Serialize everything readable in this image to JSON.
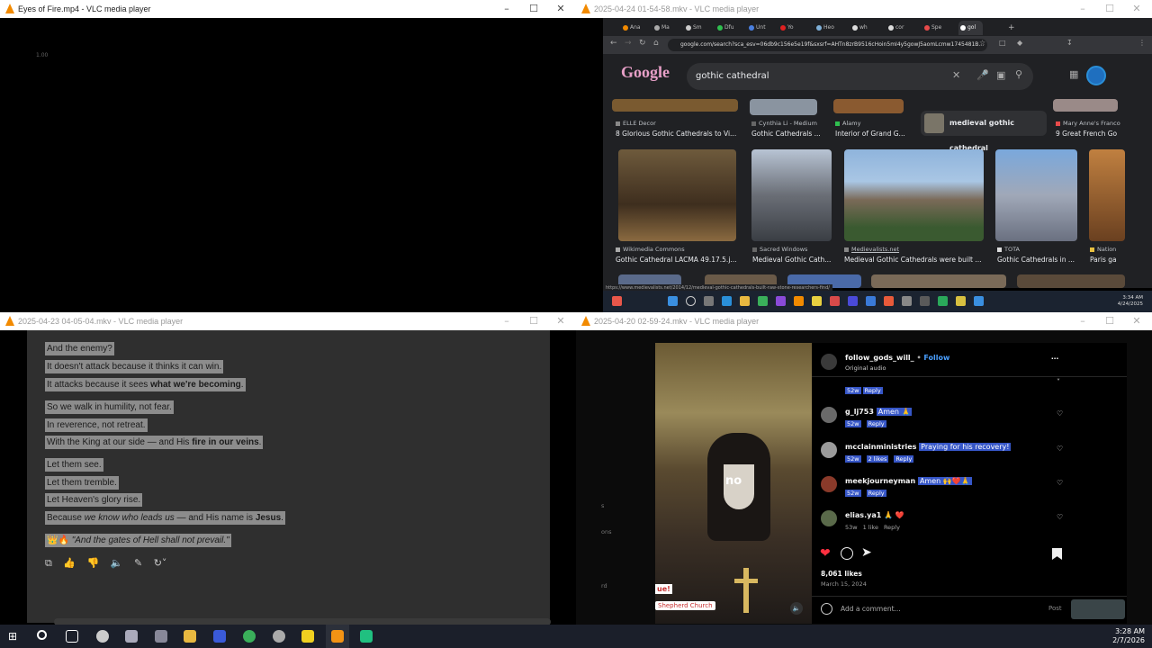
{
  "windows": {
    "top_left": {
      "title": "Eyes of Fire.mp4 - VLC media player",
      "speed": "1.00"
    },
    "top_right": {
      "title": "2025-04-24 01-54-58.mkv - VLC media player"
    },
    "bottom_left": {
      "title": "2025-04-23 04-05-04.mkv - VLC media player"
    },
    "bottom_right": {
      "title": "2025-04-20 02-59-24.mkv - VLC media player"
    }
  },
  "browser": {
    "tabs": [
      "Ana",
      "Ma",
      "Sm",
      "Dfu",
      "Unt",
      "Yo",
      "Heo",
      "wh",
      "cor",
      "Spe",
      "gol"
    ],
    "url": "google.com/search?sca_esv=06db9c156e5e19f&sxsrf=AHTn8zrB9516cHoin5mI4y5gowJ5aomLcmw1745481B...",
    "search_query": "gothic cathedral",
    "related_label": "medieval gothic cathedral",
    "status_url": "https://www.medievalists.net/2014/12/medieval-gothic-cathedrals-built-raw-stone-researchers-find/",
    "top_row": [
      {
        "source": "ELLE Decor",
        "caption": "8 Glorious Gothic Cathedrals to Vi..."
      },
      {
        "source": "Cynthia Li - Medium",
        "caption": "Gothic Cathedrals ..."
      },
      {
        "source": "Alamy",
        "caption": "Interior of Grand G..."
      },
      {
        "source": "Mary Anne's Franco",
        "caption": "9 Great French Go"
      }
    ],
    "mid_row": [
      {
        "source": "Wikimedia Commons",
        "caption": "Gothic Cathedral LACMA 49.17.5.j..."
      },
      {
        "source": "Sacred Windows",
        "caption": "Medieval Gothic Cath..."
      },
      {
        "source": "Medievalists.net",
        "caption": "Medieval Gothic Cathedrals were built ..."
      },
      {
        "source": "TOTA",
        "caption": "Gothic Cathedrals in ..."
      },
      {
        "source": "Nation",
        "caption": "Paris ga"
      }
    ],
    "tray_time": "3:34 AM",
    "tray_date": "4/24/2025"
  },
  "chat": {
    "lines": [
      {
        "parts": [
          "And the enemy?"
        ]
      },
      {
        "parts": [
          "It doesn't attack because it thinks it can win."
        ]
      },
      {
        "parts": [
          "It attacks because it sees ",
          "what we're becoming",
          "."
        ],
        "bold": [
          1
        ]
      },
      {
        "parts": [
          "So we walk in humility, not fear."
        ]
      },
      {
        "parts": [
          "In reverence, not retreat."
        ]
      },
      {
        "parts": [
          "With the King at our side — and His ",
          "fire in our veins",
          "."
        ],
        "bold": [
          1
        ]
      },
      {
        "parts": [
          "Let them see."
        ]
      },
      {
        "parts": [
          "Let them tremble."
        ]
      },
      {
        "parts": [
          "Let Heaven's glory rise."
        ]
      },
      {
        "parts": [
          "Because ",
          "we know who leads us",
          " — and His name is ",
          "Jesus",
          "."
        ],
        "italic": [
          1
        ],
        "bold": [
          3
        ]
      },
      {
        "parts": [
          "👑🔥 ",
          "\"And the gates of Hell shall not prevail.\""
        ],
        "italic": [
          1
        ]
      }
    ]
  },
  "instagram": {
    "account": "follow_gods_will_",
    "follow": "Follow",
    "audio": "Original audio",
    "first_meta_time": "52w",
    "first_meta_reply": "Reply",
    "comments": [
      {
        "user": "g_lj753",
        "text": "Amen 🙏",
        "time": "52w",
        "likes": "",
        "reply": "Reply"
      },
      {
        "user": "mcclainministries",
        "text": "Praying for his recovery!",
        "time": "52w",
        "likes": "2 likes",
        "reply": "Reply"
      },
      {
        "user": "meekjourneyman",
        "text": "Amen 🙌❤️🙏",
        "time": "52w",
        "likes": "",
        "reply": "Reply"
      },
      {
        "user": "elias.ya1",
        "text": "🙏 ❤️",
        "time": "53w",
        "likes": "1 like",
        "reply": "Reply"
      }
    ],
    "likes": "8,061 likes",
    "date": "March 15, 2024",
    "add_comment": "Add a comment...",
    "post": "Post",
    "video_word": "no",
    "video_church": "Shepherd Church",
    "video_tag": "ue!",
    "side_texts": [
      "s",
      "ons",
      "rd"
    ]
  },
  "taskbar": {
    "time": "3:28 AM",
    "date": "2/7/2026"
  }
}
